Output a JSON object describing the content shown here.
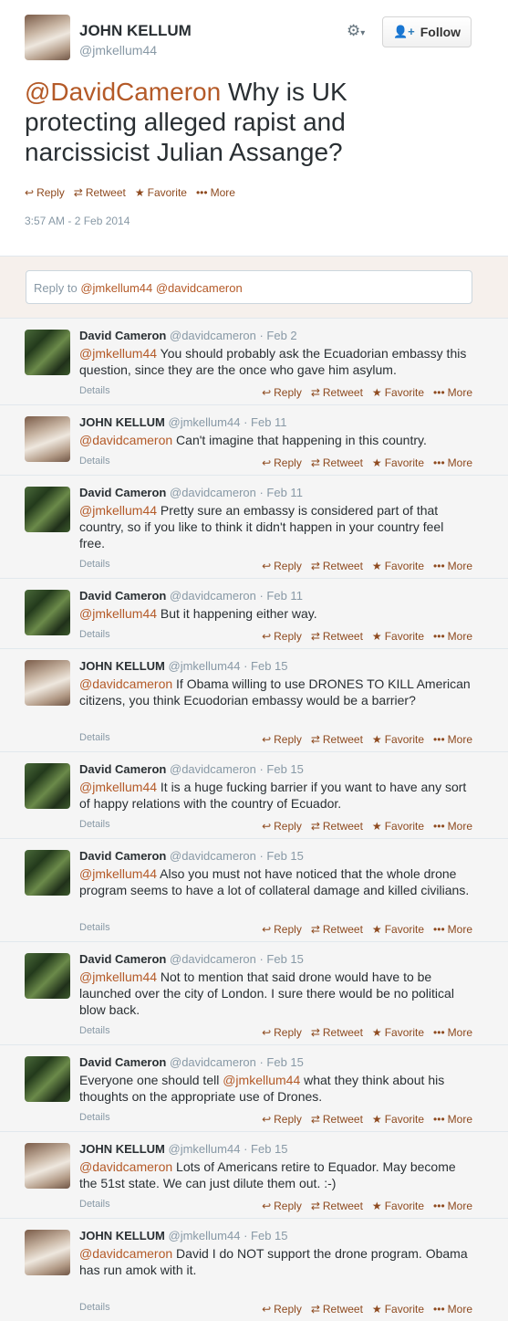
{
  "main": {
    "name": "JOHN KELLUM",
    "handle": "@jmkellum44",
    "follow_label": "Follow",
    "mention": "@DavidCameron",
    "text": " Why is UK protecting alleged rapist and narcissicist Julian Assange?",
    "actions": {
      "reply": "Reply",
      "retweet": "Retweet",
      "favorite": "Favorite",
      "more": "More"
    },
    "timestamp": "3:57 AM - 2 Feb 2014"
  },
  "reply_box": {
    "prefix": "Reply to ",
    "mentions": "@jmkellum44 @davidcameron"
  },
  "common": {
    "details": "Details",
    "reply": "Reply",
    "retweet": "Retweet",
    "favorite": "Favorite",
    "more": "More",
    "sep": " · "
  },
  "replies": [
    {
      "who": "dc",
      "name": "David Cameron",
      "handle": "@davidcameron",
      "date": "Feb 2",
      "mention": "@jmkellum44",
      "text": " You should probably ask the  Ecuadorian embassy this question, since they are the once who gave him asylum."
    },
    {
      "who": "jk",
      "name": "JOHN KELLUM",
      "handle": "@jmkellum44",
      "date": "Feb 11",
      "mention": "@davidcameron",
      "text": " Can't imagine that happening in this country."
    },
    {
      "who": "dc",
      "name": "David Cameron",
      "handle": "@davidcameron",
      "date": "Feb 11",
      "mention": "@jmkellum44",
      "text": " Pretty sure an embassy is considered part of that country, so if you like to think it didn't happen in your country feel free."
    },
    {
      "who": "dc",
      "name": "David Cameron",
      "handle": "@davidcameron",
      "date": "Feb 11",
      "mention": "@jmkellum44",
      "text": " But it happening either way."
    },
    {
      "who": "jk",
      "name": "JOHN KELLUM",
      "handle": "@jmkellum44",
      "date": "Feb 15",
      "mention": "@davidcameron",
      "text": " If Obama willing to use DRONES TO KILL American citizens, you think Ecuodorian embassy would be a barrier?"
    },
    {
      "who": "dc",
      "name": "David Cameron",
      "handle": "@davidcameron",
      "date": "Feb 15",
      "mention": "@jmkellum44",
      "text": " It is a huge fucking barrier if you want to have any sort of happy relations with the country of Ecuador."
    },
    {
      "who": "dc",
      "name": "David Cameron",
      "handle": "@davidcameron",
      "date": "Feb 15",
      "mention": "@jmkellum44",
      "text": " Also you must not have noticed that the whole drone program seems to have a lot of collateral damage and killed civilians."
    },
    {
      "who": "dc",
      "name": "David Cameron",
      "handle": "@davidcameron",
      "date": "Feb 15",
      "mention": "@jmkellum44",
      "text": " Not to mention that said drone would have to be launched over the city of London. I sure there would be no political blow back."
    },
    {
      "who": "dc",
      "name": "David Cameron",
      "handle": "@davidcameron",
      "date": "Feb 15",
      "pre": "Everyone one should tell ",
      "mention": "@jmkellum44",
      "text": " what they think about his thoughts on the appropriate use of Drones."
    },
    {
      "who": "jk",
      "name": "JOHN KELLUM",
      "handle": "@jmkellum44",
      "date": "Feb 15",
      "mention": "@davidcameron",
      "text": " Lots of Americans retire to Equador. May become the 51st state. We can just dilute them out. :-)"
    },
    {
      "who": "jk",
      "name": "JOHN KELLUM",
      "handle": "@jmkellum44",
      "date": "Feb 15",
      "mention": "@davidcameron",
      "text": " David I do NOT support the drone program. Obama has run amok with it."
    }
  ]
}
